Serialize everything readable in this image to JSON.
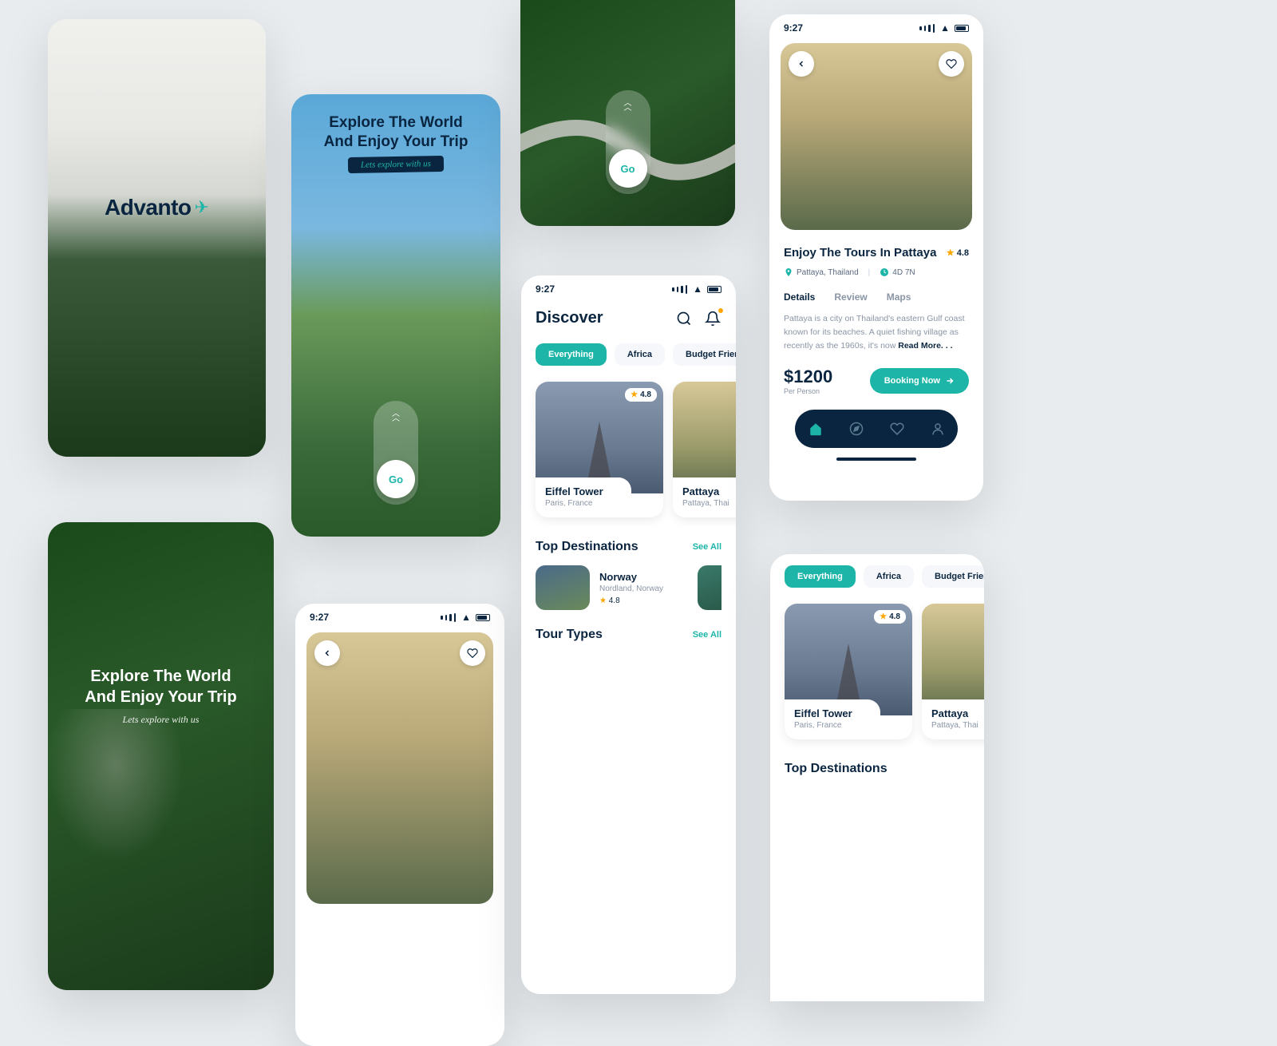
{
  "status_time": "9:27",
  "brand": {
    "name": "Advanto"
  },
  "onboarding": {
    "title_line1": "Explore The World",
    "title_line2": "And Enjoy Your Trip",
    "subtitle": "Lets explore with us",
    "go_label": "Go"
  },
  "discover": {
    "title": "Discover",
    "chips": {
      "everything": "Everything",
      "africa": "Africa",
      "budget": "Budget Friendly"
    },
    "cards": [
      {
        "name": "Eiffel Tower",
        "location": "Paris, France",
        "rating": "4.8"
      },
      {
        "name": "Pattaya",
        "location": "Pattaya, Thai"
      }
    ],
    "top_destinations": {
      "title": "Top Destinations",
      "see_all": "See All",
      "item": {
        "name": "Norway",
        "location": "Nordland, Norway",
        "rating": "4.8"
      }
    },
    "tour_types": {
      "title": "Tour Types",
      "see_all": "See All"
    }
  },
  "detail": {
    "title": "Enjoy The Tours In Pattaya",
    "rating": "4.8",
    "location": "Pattaya, Thailand",
    "duration": "4D 7N",
    "tabs": {
      "details": "Details",
      "review": "Review",
      "maps": "Maps"
    },
    "description": "Pattaya is a city on Thailand's eastern Gulf coast known for its beaches. A quiet fishing village as recently as the 1960s, it's now ",
    "read_more": "Read More. . .",
    "price": "$1200",
    "price_label": "Per Person",
    "book_label": "Booking Now"
  }
}
